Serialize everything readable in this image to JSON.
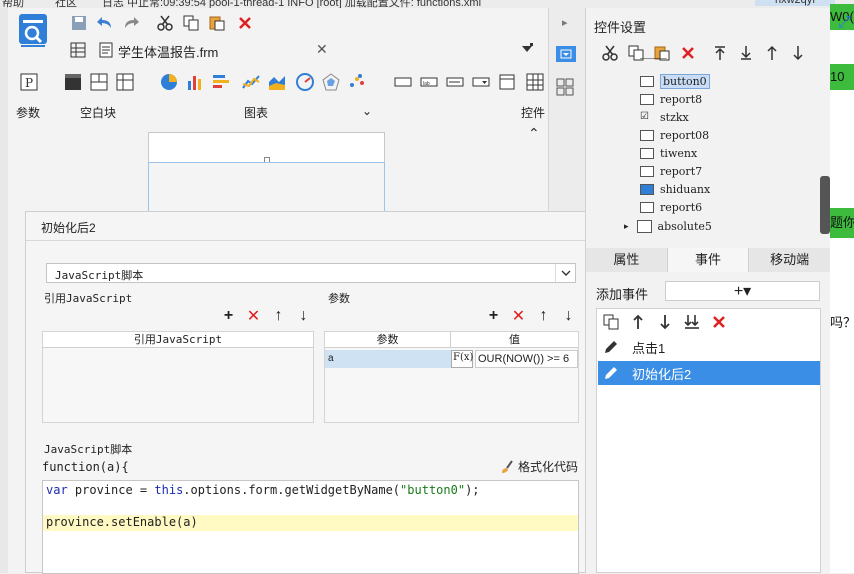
{
  "top_strip": {
    "items": [
      "帮助",
      "社区",
      "日志  中止常:09:39:54 pool-1-thread-1 INFO [root] 加载配置文件: functions.xml",
      "nxw2qyf"
    ]
  },
  "document": {
    "tab_title": "学生体温报告.frm"
  },
  "ribbon": {
    "groups": [
      {
        "label": "参数"
      },
      {
        "label": "空白块"
      },
      {
        "label": "图表"
      },
      {
        "label": "控件"
      }
    ]
  },
  "dialog": {
    "title": "初始化后2",
    "script_type": "JavaScript脚本",
    "ref_js_label": "引用JavaScript",
    "ref_js_column": "引用JavaScript",
    "params_label": "参数",
    "params_columns": [
      "参数",
      "值"
    ],
    "param_row": {
      "name": "a",
      "fx": "F(x)",
      "value": "OUR(NOW()) >= 6"
    },
    "script_label": "JavaScript脚本",
    "function_sig": "function(a){",
    "format_code": "格式化代码",
    "code": {
      "l1_kw1": "var",
      "l1_mid": " province = ",
      "l1_kw2": "this",
      "l1_rest": ".options.form.getWidgetByName(",
      "l1_str": "\"button0\"",
      "l1_end": ");",
      "l3": "province.setEnable(a)"
    }
  },
  "right_panel": {
    "title": "控件设置",
    "tree": [
      {
        "label": "button0",
        "selected": true
      },
      {
        "label": "report8"
      },
      {
        "label": "stzkx"
      },
      {
        "label": "report08"
      },
      {
        "label": "tiwenx"
      },
      {
        "label": "report7"
      },
      {
        "label": "shiduanx"
      },
      {
        "label": "report6"
      },
      {
        "label": "absolute5"
      }
    ],
    "tabs": [
      "属性",
      "事件",
      "移动端"
    ],
    "active_tab": "事件",
    "add_event_label": "添加事件",
    "add_event_symbol": "+▾",
    "events": [
      {
        "label": "点击1",
        "selected": false
      },
      {
        "label": "初始化后2",
        "selected": true
      }
    ]
  },
  "background_window": {
    "fragments": [
      "W0(",
      "10",
      "题你",
      "吗？"
    ]
  },
  "colors": {
    "accent": "#3a8ee6",
    "delete_red": "#e02020",
    "code_highlight": "#fff9c4",
    "green": "#3dbb3d"
  }
}
